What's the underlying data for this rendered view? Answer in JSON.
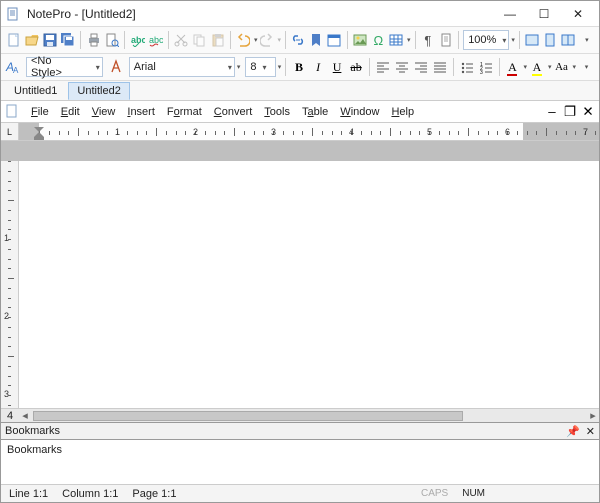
{
  "window": {
    "title": "NotePro - [Untitled2]",
    "controls": {
      "min": "—",
      "max": "☐",
      "close": "✕"
    }
  },
  "toolbar1": {
    "zoom": "100%"
  },
  "toolbar2": {
    "style_label": "<No Style>",
    "font_label": "Arial",
    "size_label": "8",
    "bold": "B",
    "italic": "I",
    "under": "U",
    "strike": "ab",
    "chars": {
      "A_font": "A",
      "A_hl": "A",
      "A_case": "Aa"
    }
  },
  "doc_tabs": [
    "Untitled1",
    "Untitled2"
  ],
  "active_tab_index": 1,
  "menu": [
    "File",
    "Edit",
    "View",
    "Insert",
    "Format",
    "Convert",
    "Tools",
    "Table",
    "Window",
    "Help"
  ],
  "ruler": {
    "numbers": [
      "1",
      "2",
      "3",
      "4",
      "5",
      "6",
      "7"
    ]
  },
  "vruler": {
    "numbers": [
      "1",
      "2",
      "3"
    ]
  },
  "bookmarks": {
    "header": "Bookmarks",
    "body": "Bookmarks"
  },
  "status": {
    "line": "Line 1:1",
    "column": "Column 1:1",
    "page": "Page 1:1",
    "caps": "CAPS",
    "num": "NUM"
  }
}
